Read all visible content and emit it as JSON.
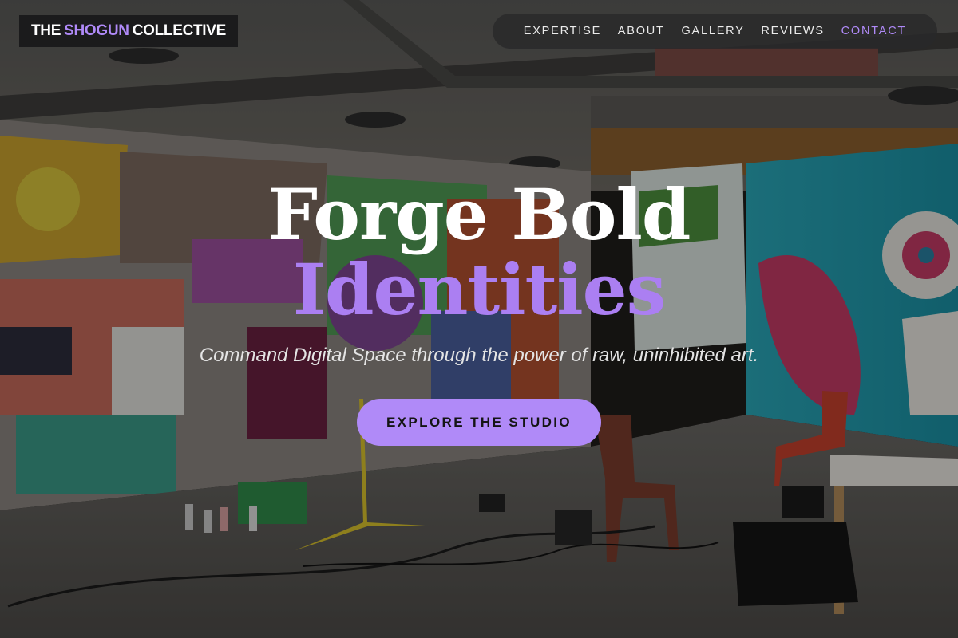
{
  "brand": {
    "prefix": "THE",
    "highlight": "SHOGUN",
    "suffix": "COLLECTIVE",
    "accent_color": "#b08af8"
  },
  "nav": {
    "items": [
      {
        "label": "EXPERTISE"
      },
      {
        "label": "ABOUT"
      },
      {
        "label": "GALLERY"
      },
      {
        "label": "REVIEWS"
      },
      {
        "label": "CONTACT",
        "active": true
      }
    ]
  },
  "hero": {
    "headline_line1": "Forge Bold",
    "headline_line2": "Identities",
    "tagline": "Command Digital Space through the power of raw, uninhibited art.",
    "cta_label": "EXPLORE THE STUDIO",
    "background": "graffiti-studio-photo"
  }
}
